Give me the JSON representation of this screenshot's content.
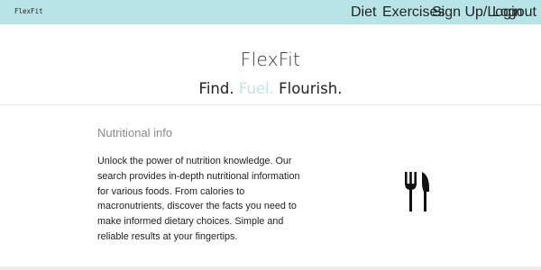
{
  "navbar": {
    "brand": "FlexFit",
    "links": [
      {
        "label": "Diet"
      },
      {
        "label": "Exercises"
      },
      {
        "label": "Sign Up/Login"
      },
      {
        "label": "Logout"
      }
    ]
  },
  "hero": {
    "title": "FlexFit",
    "tagline": [
      "Find.",
      "Fuel.",
      "Flourish."
    ]
  },
  "section": {
    "title": "Nutritional info",
    "body": "Unlock the power of nutrition knowledge. Our search provides in-depth nutritional information for various foods. From calories to macronutrients, discover the facts you need to make informed dietary choices. Simple and reliable results at your fingertips.",
    "icon": "fork-knife-icon"
  },
  "colors": {
    "navbar_bg": "#b8e4e8",
    "accent": "#bfe3e6"
  }
}
